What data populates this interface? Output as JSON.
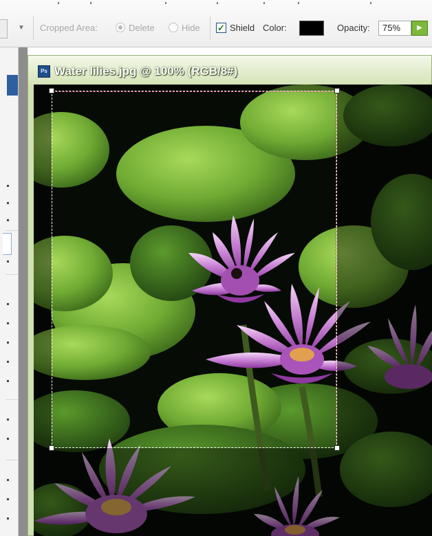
{
  "options_bar": {
    "cropped_area_label": "Cropped Area:",
    "delete_label": "Delete",
    "hide_label": "Hide",
    "shield_label": "Shield",
    "shield_checked": true,
    "color_label": "Color:",
    "shield_color": "#000000",
    "opacity_label": "Opacity:",
    "opacity_value": "75%"
  },
  "document": {
    "title": "Water lilies.jpg @ 100% (RGB/8#)",
    "icon": "ps-file-icon"
  },
  "colors": {
    "titlebar": "#d5e4b8",
    "opacity_button": "#7cb83a",
    "crop_border": "#ffffff"
  }
}
